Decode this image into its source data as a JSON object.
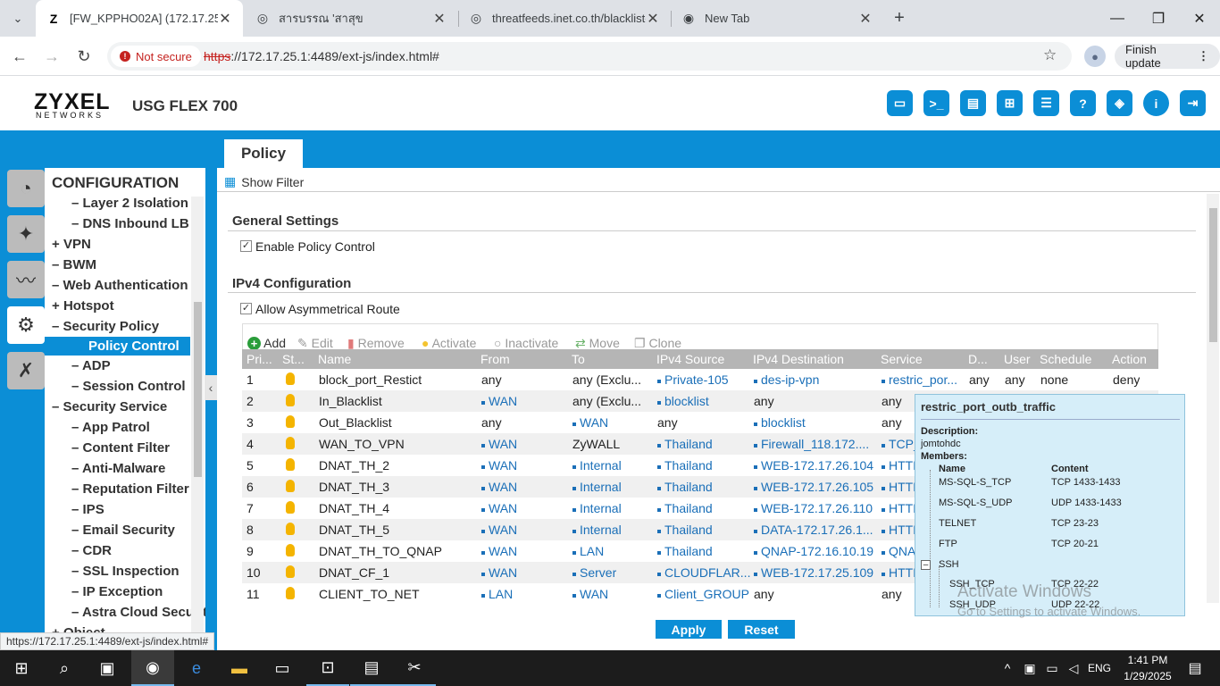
{
  "browser": {
    "tabs": [
      {
        "title": "[FW_KPPHO02A] (172.17.25.1:4",
        "icon": "zyxel-z-icon"
      },
      {
        "title": "สารบรรณ 'สาสุข",
        "icon": "globe-icon"
      },
      {
        "title": "threatfeeds.inet.co.th/blacklist-i",
        "icon": "globe-icon"
      },
      {
        "title": "New Tab",
        "icon": "chrome-icon"
      }
    ],
    "security_label": "Not secure",
    "url_scheme": "https",
    "url_rest": "://172.17.25.1:4489/ext-js/index.html#",
    "finish_update": "Finish update",
    "status_url": "https://172.17.25.1:4489/ext-js/index.html#"
  },
  "header": {
    "logo": "ZYXEL",
    "logo_sub": "NETWORKS",
    "model": "USG FLEX 700",
    "icons": [
      "console-icon",
      "cli-icon",
      "monitor-icon",
      "network-map-icon",
      "chat-icon",
      "help-icon",
      "support-icon",
      "info-icon",
      "logout-icon"
    ]
  },
  "page_tab": "Policy",
  "nav": {
    "heading": "CONFIGURATION",
    "items": [
      {
        "label": "Layer 2 Isolation",
        "prefix": "–"
      },
      {
        "label": "DNS Inbound LB",
        "prefix": "–"
      },
      {
        "label": "VPN",
        "prefix": "+"
      },
      {
        "label": "BWM",
        "prefix": "–"
      },
      {
        "label": "Web Authentication",
        "prefix": "–"
      },
      {
        "label": "Hotspot",
        "prefix": "+"
      },
      {
        "label": "Security Policy",
        "prefix": "–"
      },
      {
        "label": "Policy Control",
        "prefix": "",
        "selected": true
      },
      {
        "label": "ADP",
        "prefix": "–"
      },
      {
        "label": "Session Control",
        "prefix": "–"
      },
      {
        "label": "Security Service",
        "prefix": "–"
      },
      {
        "label": "App Patrol",
        "prefix": "–"
      },
      {
        "label": "Content Filter",
        "prefix": "–"
      },
      {
        "label": "Anti-Malware",
        "prefix": "–"
      },
      {
        "label": "Reputation Filter",
        "prefix": "–"
      },
      {
        "label": "IPS",
        "prefix": "–"
      },
      {
        "label": "Email Security",
        "prefix": "–"
      },
      {
        "label": "CDR",
        "prefix": "–"
      },
      {
        "label": "SSL Inspection",
        "prefix": "–"
      },
      {
        "label": "IP Exception",
        "prefix": "–"
      },
      {
        "label": "Astra Cloud Security",
        "prefix": "–"
      },
      {
        "label": "Object",
        "prefix": "+"
      }
    ]
  },
  "content": {
    "show_filter": "Show Filter",
    "general_settings": "General Settings",
    "enable_policy_control": "Enable Policy Control",
    "ipv4_configuration": "IPv4 Configuration",
    "allow_asym_route": "Allow Asymmetrical Route",
    "toolbar": [
      "Add",
      "Edit",
      "Remove",
      "Activate",
      "Inactivate",
      "Move",
      "Clone"
    ],
    "columns": [
      "Pri...",
      "St...",
      "Name",
      "From",
      "To",
      "IPv4 Source",
      "IPv4 Destination",
      "Service",
      "D...",
      "User",
      "Schedule",
      "Action"
    ],
    "rows": [
      [
        "1",
        "",
        "block_port_Restict",
        "any",
        "any (Exclu...",
        "Private-105",
        "des-ip-vpn",
        "restric_por...",
        "any",
        "any",
        "none",
        "deny"
      ],
      [
        "2",
        "",
        "In_Blacklist",
        "WAN",
        "any (Exclu...",
        "blocklist",
        "any",
        "any",
        "",
        "",
        "",
        ""
      ],
      [
        "3",
        "",
        "Out_Blacklist",
        "any",
        "WAN",
        "any",
        "blocklist",
        "any",
        "",
        "",
        "",
        ""
      ],
      [
        "4",
        "",
        "WAN_TO_VPN",
        "WAN",
        "ZyWALL",
        "Thailand",
        "Firewall_118.172....",
        "TCP_",
        "",
        "",
        "",
        ""
      ],
      [
        "5",
        "",
        "DNAT_TH_2",
        "WAN",
        "Internal",
        "Thailand",
        "WEB-172.17.26.104",
        "HTTP",
        "",
        "",
        "",
        ""
      ],
      [
        "6",
        "",
        "DNAT_TH_3",
        "WAN",
        "Internal",
        "Thailand",
        "WEB-172.17.26.105",
        "HTTP",
        "",
        "",
        "",
        ""
      ],
      [
        "7",
        "",
        "DNAT_TH_4",
        "WAN",
        "Internal",
        "Thailand",
        "WEB-172.17.26.110",
        "HTTP",
        "",
        "",
        "",
        ""
      ],
      [
        "8",
        "",
        "DNAT_TH_5",
        "WAN",
        "Internal",
        "Thailand",
        "DATA-172.17.26.1...",
        "HTTP",
        "",
        "",
        "",
        ""
      ],
      [
        "9",
        "",
        "DNAT_TH_TO_QNAP",
        "WAN",
        "LAN",
        "Thailand",
        "QNAP-172.16.10.19",
        "QNA",
        "",
        "",
        "",
        ""
      ],
      [
        "10",
        "",
        "DNAT_CF_1",
        "WAN",
        "Server",
        "CLOUDFLAR...",
        "WEB-172.17.25.109",
        "HTTP",
        "",
        "",
        "",
        ""
      ],
      [
        "11",
        "",
        "CLIENT_TO_NET",
        "LAN",
        "WAN",
        "Client_GROUP",
        "any",
        "any",
        "",
        "",
        "",
        ""
      ]
    ],
    "apply": "Apply",
    "reset": "Reset"
  },
  "popup": {
    "title": "restric_port_outb_traffic",
    "description_label": "Description:",
    "description": "jomtohdc",
    "members_label": "Members:",
    "col_name": "Name",
    "col_content": "Content",
    "members": [
      [
        "MS-SQL-S_TCP",
        "TCP 1433-1433"
      ],
      [
        "MS-SQL-S_UDP",
        "UDP 1433-1433"
      ],
      [
        "TELNET",
        "TCP 23-23"
      ],
      [
        "FTP",
        "TCP 20-21"
      ]
    ],
    "group_name": "SSH",
    "group_members": [
      [
        "SSH_TCP",
        "TCP 22-22"
      ],
      [
        "SSH_UDP",
        "UDP 22-22"
      ]
    ]
  },
  "watermark": {
    "line1": "Activate Windows",
    "line2": "Go to Settings to activate Windows."
  },
  "taskbar": {
    "lang": "ENG",
    "time": "1:41 PM",
    "date": "1/29/2025"
  }
}
